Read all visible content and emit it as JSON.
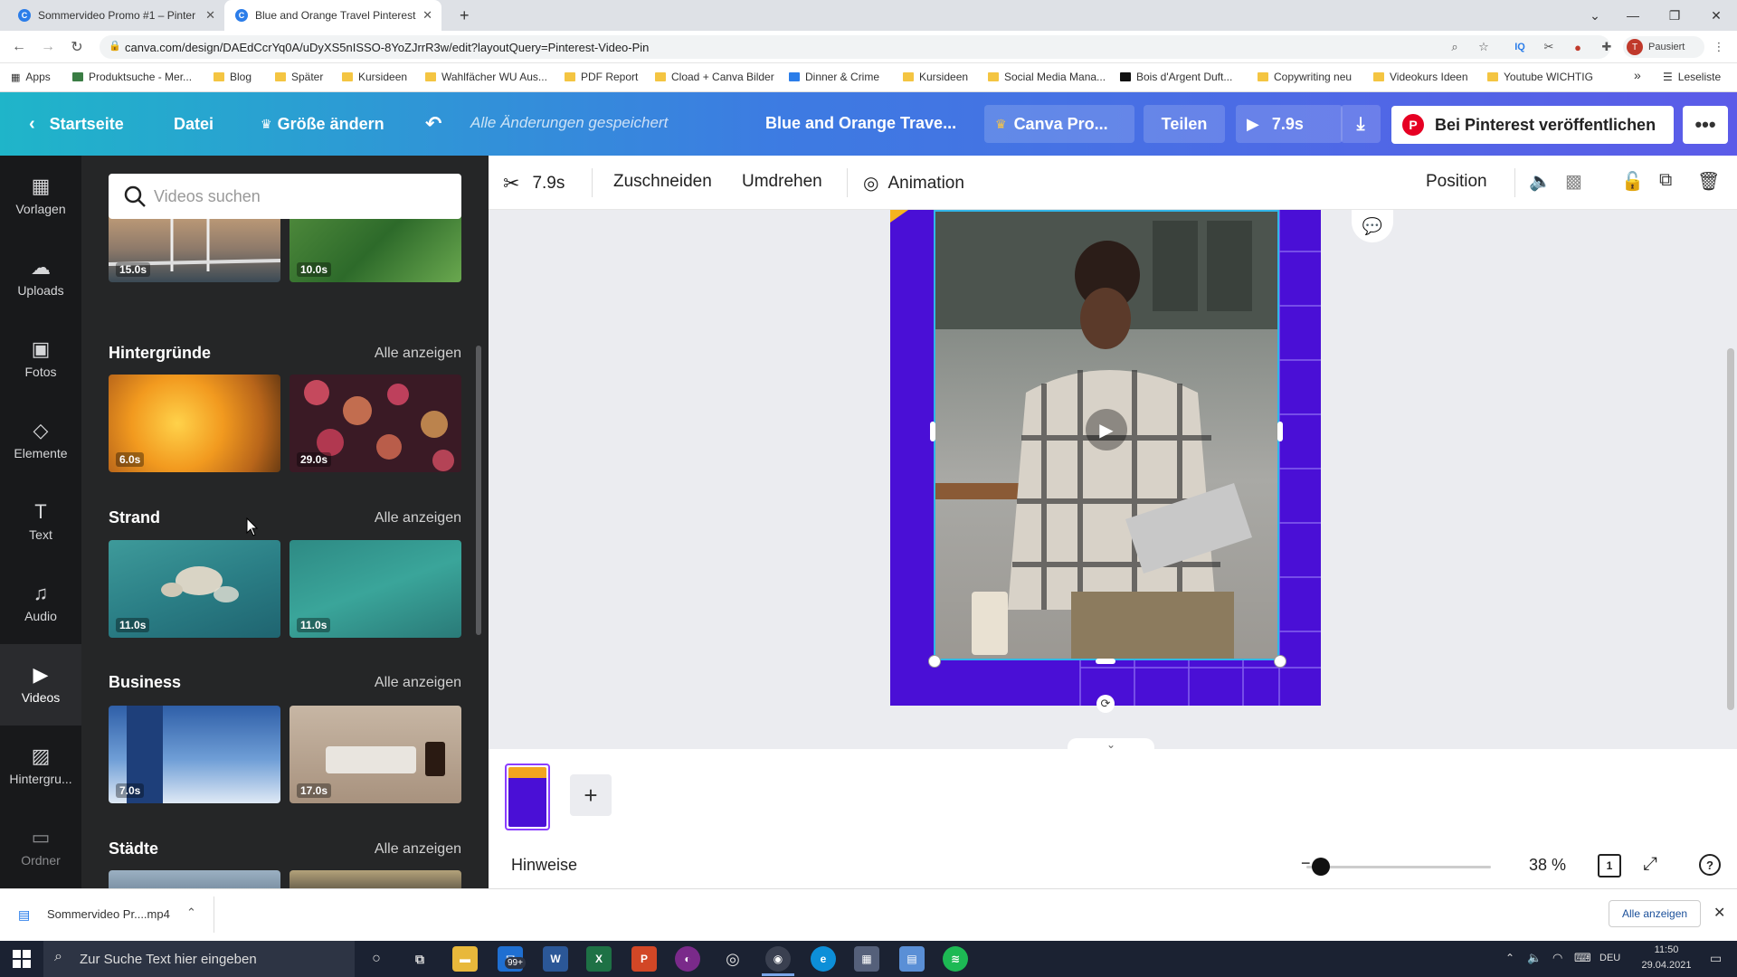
{
  "browser": {
    "tabs": [
      {
        "title": "Sommervideo Promo #1 – Pinter",
        "active": false
      },
      {
        "title": "Blue and Orange Travel Pinterest",
        "active": true
      }
    ],
    "new_tab": "+",
    "url": "canva.com/design/DAEdCcrYq0A/uDyXS5nISSO-8YoZJrrR3w/edit?layoutQuery=Pinterest-Video-Pin",
    "profile_label": "Pausiert",
    "profile_initial": "T",
    "bookmarks": [
      "Apps",
      "Produktsuche - Mer...",
      "Blog",
      "Später",
      "Kursideen",
      "Wahlfächer WU Aus...",
      "PDF Report",
      "Cload + Canva Bilder",
      "Dinner & Crime",
      "Kursideen",
      "Social Media Mana...",
      "Bois d'Argent Duft...",
      "Copywriting neu",
      "Videokurs Ideen",
      "Youtube WICHTIG"
    ],
    "bookmarks_more": "»",
    "reading_list": "Leseliste"
  },
  "header": {
    "home": "Startseite",
    "file": "Datei",
    "resize": "Größe ändern",
    "saved_status": "Alle Änderungen gespeichert",
    "doc_title": "Blue and Orange Trave...",
    "canva_pro": "Canva Pro...",
    "share": "Teilen",
    "play_duration": "7.9s",
    "publish": "Bei Pinterest veröffentlichen",
    "more": "•••"
  },
  "rail": [
    {
      "label": "Vorlagen",
      "icon": "▦"
    },
    {
      "label": "Uploads",
      "icon": "☁"
    },
    {
      "label": "Fotos",
      "icon": "▣"
    },
    {
      "label": "Elemente",
      "icon": "◇"
    },
    {
      "label": "Text",
      "icon": "T"
    },
    {
      "label": "Audio",
      "icon": "♫"
    },
    {
      "label": "Videos",
      "icon": "▶"
    },
    {
      "label": "Hintergru...",
      "icon": "▨"
    },
    {
      "label": "Ordner",
      "icon": "▭"
    }
  ],
  "panel": {
    "search_placeholder": "Videos suchen",
    "top_durations": [
      "15.0s",
      "10.0s"
    ],
    "sections": [
      {
        "title": "Hintergründe",
        "see_all": "Alle anzeigen",
        "durations": [
          "6.0s",
          "29.0s"
        ]
      },
      {
        "title": "Strand",
        "see_all": "Alle anzeigen",
        "durations": [
          "11.0s",
          "11.0s"
        ]
      },
      {
        "title": "Business",
        "see_all": "Alle anzeigen",
        "durations": [
          "7.0s",
          "17.0s"
        ]
      },
      {
        "title": "Städte",
        "see_all": "Alle anzeigen",
        "durations": []
      }
    ]
  },
  "toolbar": {
    "trim_duration": "7.9s",
    "crop": "Zuschneiden",
    "flip": "Umdrehen",
    "animation": "Animation",
    "position": "Position"
  },
  "bottom": {
    "hints": "Hinweise",
    "zoom": "38 %",
    "page_count": "1",
    "add_page": "+"
  },
  "download": {
    "file": "Sommervideo Pr....mp4",
    "show_all": "Alle anzeigen"
  },
  "taskbar": {
    "search_placeholder": "Zur Suche Text hier eingeben",
    "language": "DEU",
    "time": "11:50",
    "date": "29.04.2021",
    "mail_badge": "99+"
  },
  "colors": {
    "canva_gradient_start": "#1fb5c9",
    "canva_gradient_end": "#5b5be8",
    "design_bg": "#4a0fd6",
    "pinterest_red": "#e60023"
  }
}
